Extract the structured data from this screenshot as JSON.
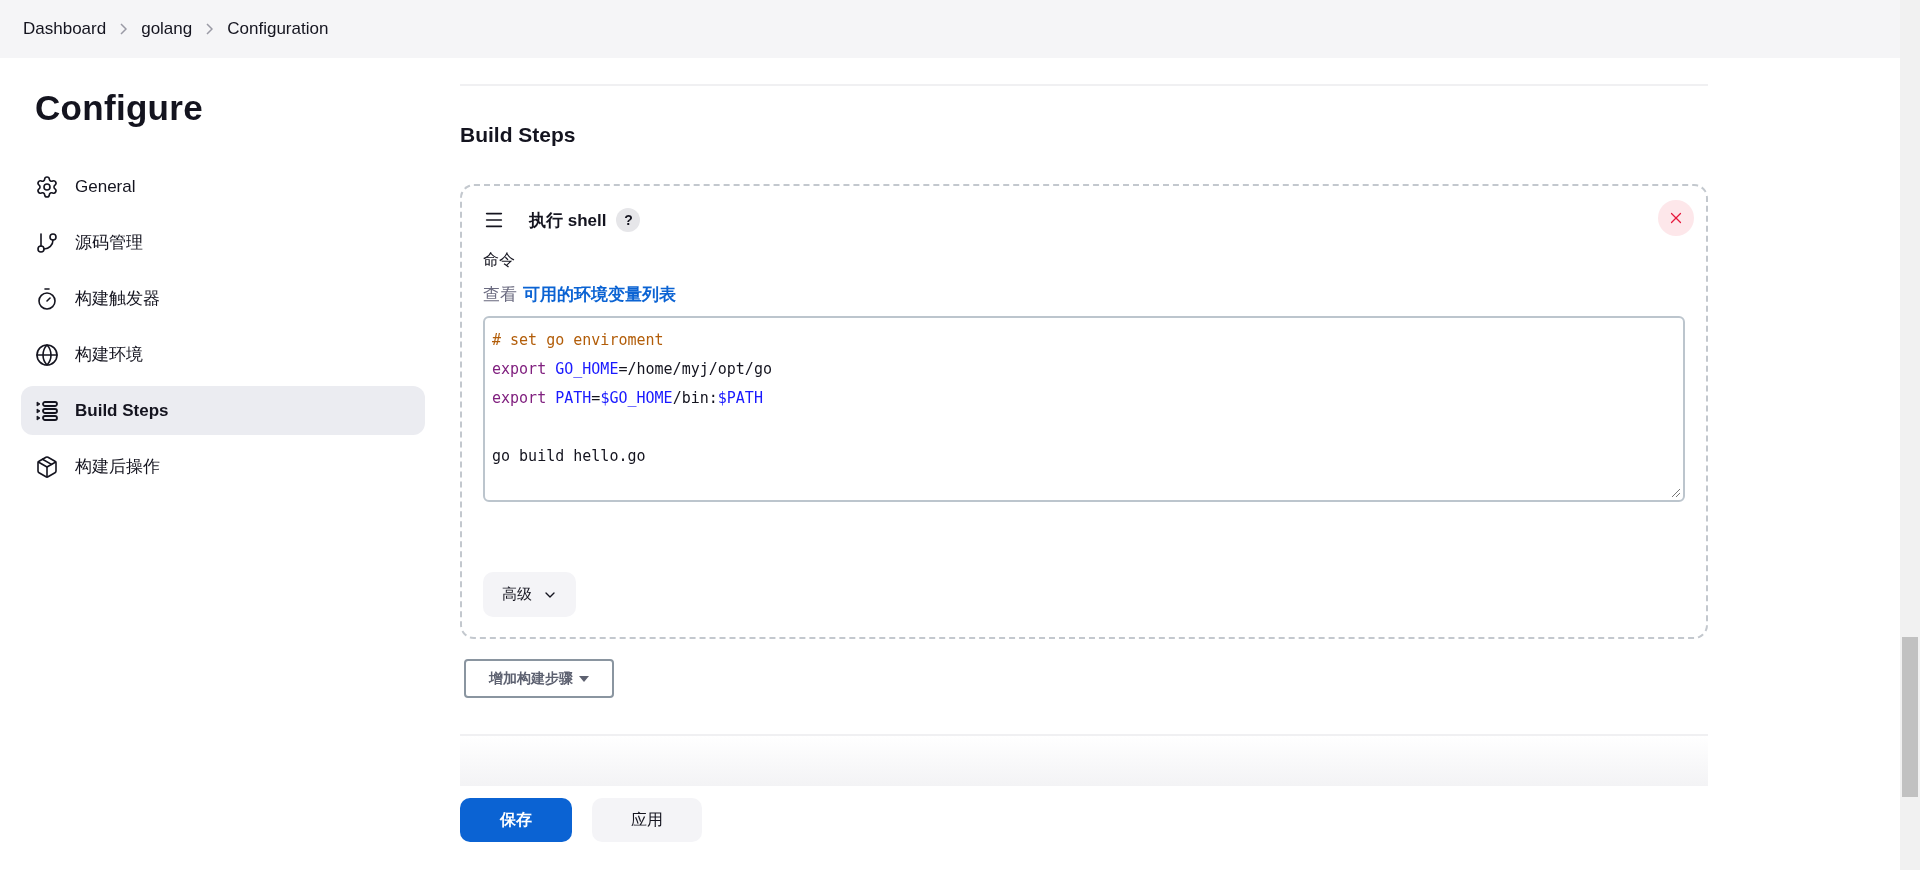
{
  "breadcrumbs": [
    {
      "label": "Dashboard"
    },
    {
      "label": "golang"
    },
    {
      "label": "Configuration"
    }
  ],
  "sidebar": {
    "title": "Configure",
    "items": [
      {
        "label": "General",
        "kind": "gear",
        "selected": false
      },
      {
        "label": "源码管理",
        "kind": "branch",
        "selected": false
      },
      {
        "label": "构建触发器",
        "kind": "timer",
        "selected": false
      },
      {
        "label": "构建环境",
        "kind": "globe",
        "selected": false
      },
      {
        "label": "Build Steps",
        "kind": "steps",
        "selected": true
      },
      {
        "label": "构建后操作",
        "kind": "package",
        "selected": false
      }
    ]
  },
  "section": {
    "title": "Build Steps",
    "step": {
      "title": "执行 shell",
      "help": "?",
      "field_label": "命令",
      "env_prefix": "查看",
      "env_link": "可用的环境变量列表",
      "code_lines": [
        {
          "kind": "code",
          "tokens": [
            {
              "text": "# set go enviroment",
              "kind": "comment"
            }
          ]
        },
        {
          "kind": "code",
          "tokens": [
            {
              "text": "export ",
              "kind": "keyword"
            },
            {
              "text": "GO_HOME",
              "kind": "variable"
            },
            {
              "text": "=/home/myj/opt/go",
              "kind": "plain"
            }
          ]
        },
        {
          "kind": "code",
          "tokens": [
            {
              "text": "export ",
              "kind": "keyword"
            },
            {
              "text": "PATH",
              "kind": "variable"
            },
            {
              "text": "=",
              "kind": "plain"
            },
            {
              "text": "$GO_HOME",
              "kind": "variable"
            },
            {
              "text": "/bin:",
              "kind": "plain"
            },
            {
              "text": "$PATH",
              "kind": "variable"
            }
          ]
        },
        {
          "kind": "blank"
        },
        {
          "kind": "code",
          "tokens": [
            {
              "text": "go build hello.go",
              "kind": "plain"
            }
          ]
        }
      ],
      "advanced_button": "高级"
    },
    "add_step_button": "增加构建步骤"
  },
  "footer": {
    "save_button": "保存",
    "apply_button": "应用"
  }
}
